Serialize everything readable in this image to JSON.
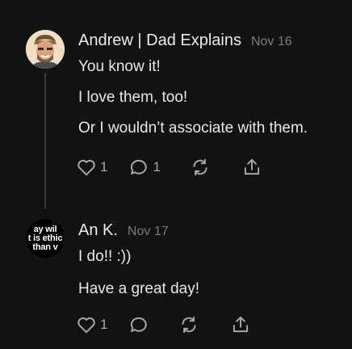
{
  "comments": [
    {
      "author": "Andrew | Dad Explains",
      "date": "Nov 16",
      "paragraphs": [
        "You know it!",
        "I love them, too!",
        "Or I wouldn’t associate with them."
      ],
      "like_count": "1",
      "reply_count": "1"
    },
    {
      "author": "An K.",
      "date": "Nov 17",
      "avatar_text": [
        "ay wil",
        "t is ethic",
        "than v"
      ],
      "paragraphs": [
        "I do!! :))",
        "Have a great day!"
      ],
      "like_count": "1",
      "reply_count": ""
    }
  ],
  "icons": [
    "heart-icon",
    "comment-bubble-icon",
    "restack-icon",
    "share-icon"
  ]
}
